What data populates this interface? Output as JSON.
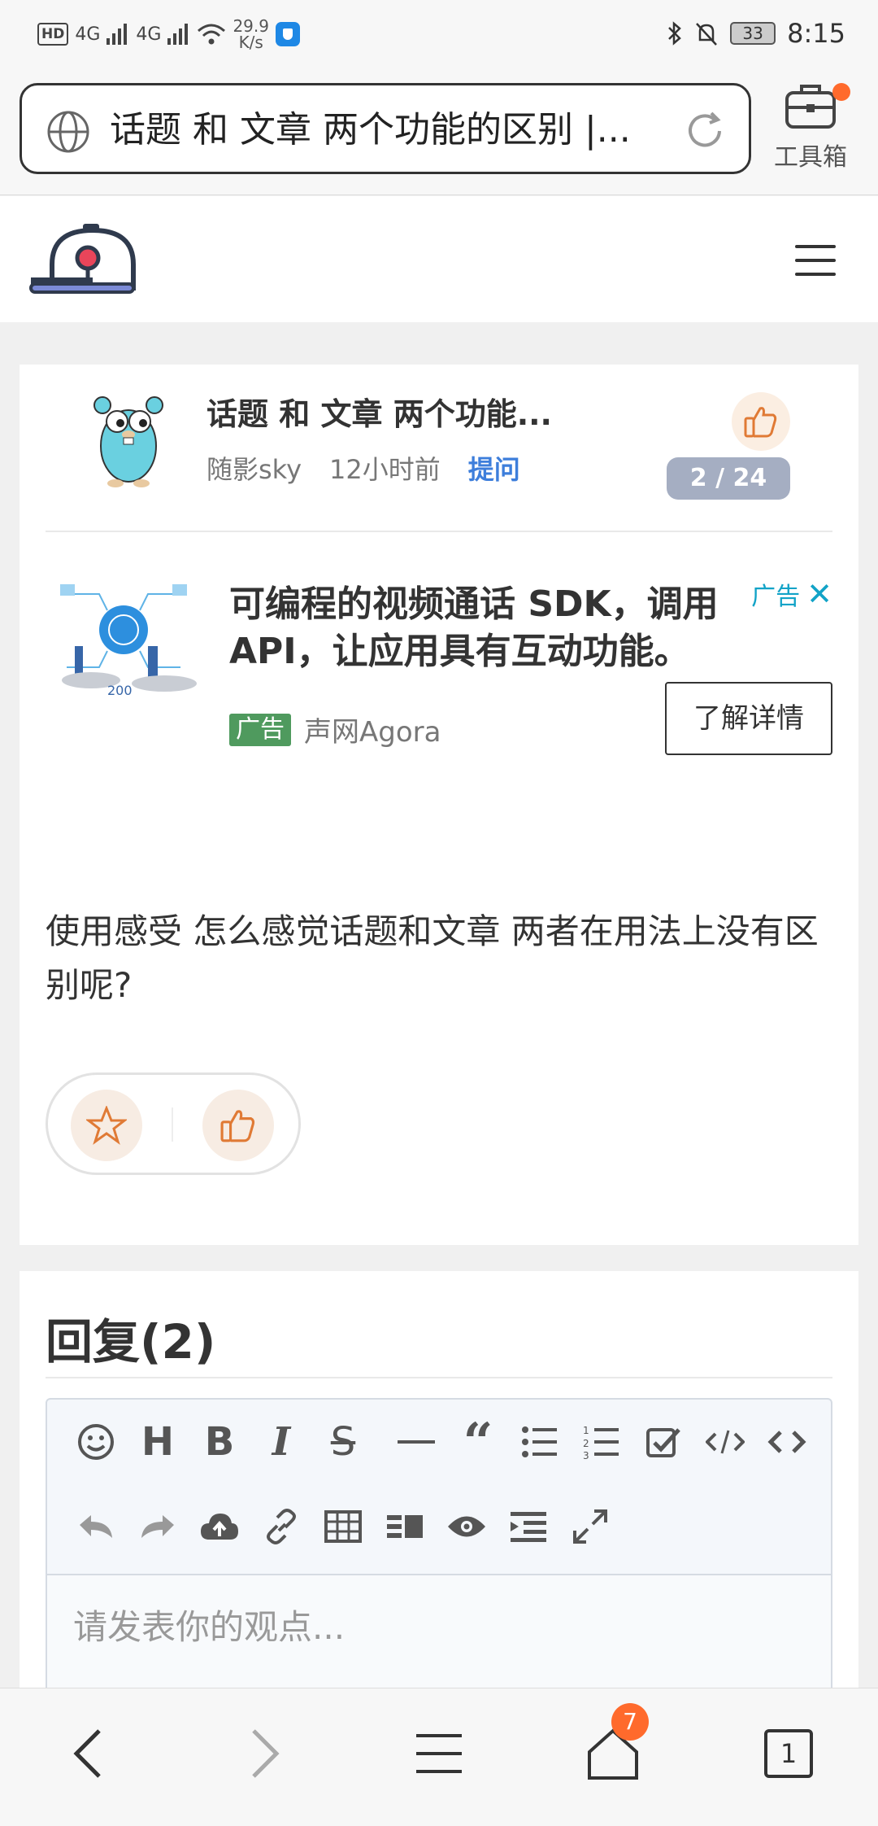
{
  "status_bar": {
    "hd": "HD",
    "net1": "4G",
    "net2": "4G",
    "speed_value": "29.9",
    "speed_unit": "K/s",
    "battery": "33",
    "time": "8:15"
  },
  "browser": {
    "url_title": "话题 和 文章 两个功能的区别 |...",
    "toolbox_label": "工具箱"
  },
  "topic": {
    "title": "话题 和 文章 两个功能...",
    "author": "随影sky",
    "time_ago": "12小时前",
    "tag": "提问",
    "counter": "2 / 24",
    "body": "使用感受 怎么感觉话题和文章 两者在用法上没有区别呢?"
  },
  "ad": {
    "title": "可编程的视频通话 SDK，调用API，让应用具有互动功能。",
    "corner_label": "广告",
    "label": "广告",
    "advertiser": "声网Agora",
    "cta": "了解详情"
  },
  "replies": {
    "title": "回复(2)",
    "placeholder": "请发表你的观点..."
  },
  "bottom_nav": {
    "tabs_count": "1",
    "home_badge": "7"
  },
  "colors": {
    "accent": "#ff6a2c",
    "tag_blue": "#3d7edb",
    "counter_bg": "#a5aec2",
    "ad_label_green": "#4f9a5e",
    "ad_corner_cyan": "#12a3c7"
  }
}
